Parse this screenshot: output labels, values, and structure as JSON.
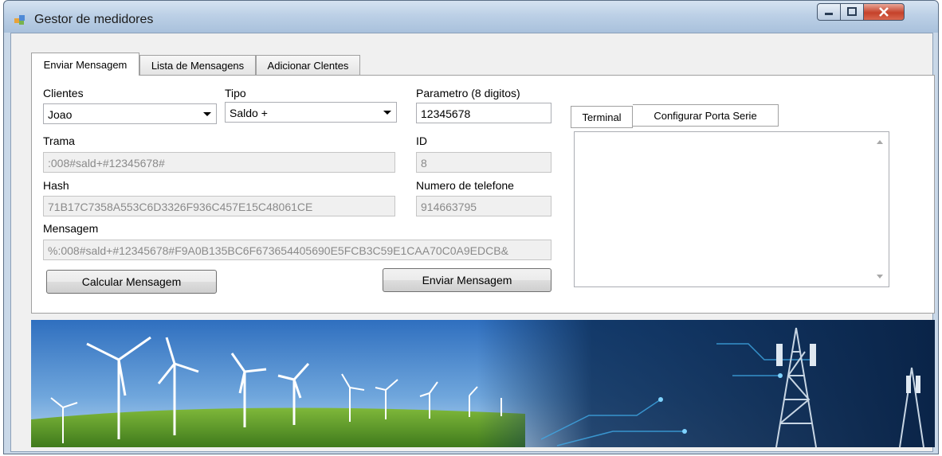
{
  "window": {
    "title": "Gestor de medidores"
  },
  "tabs": [
    "Enviar Mensagem",
    "Lista de Mensagens",
    "Adicionar Clentes"
  ],
  "form": {
    "clientes_label": "Clientes",
    "clientes_value": "Joao",
    "tipo_label": "Tipo",
    "tipo_value": "Saldo +",
    "parametro_label": "Parametro (8 digitos)",
    "parametro_value": "12345678",
    "trama_label": "Trama",
    "trama_value": ":008#sald+#12345678#",
    "id_label": "ID",
    "id_value": "8",
    "hash_label": "Hash",
    "hash_value": "71B17C7358A553C6D3326F936C457E15C48061CE",
    "telefone_label": "Numero de telefone",
    "telefone_value": "914663795",
    "mensagem_label": "Mensagem",
    "mensagem_value": "%:008#sald+#12345678#F9A0B135BC6F673654405690E5FCB3C59E1CAA70C0A9EDCB&",
    "calcular_button": "Calcular Mensagem",
    "enviar_button": "Enviar Mensagem"
  },
  "terminal_tabs": [
    "Terminal",
    "Configurar Porta Serie"
  ],
  "colors": {
    "titlebar": "#bcd0e6",
    "close_button": "#c5412a",
    "sky": "#4a8ad0",
    "grass": "#5e9b2a",
    "tech_bg": "#0d2f5a"
  }
}
